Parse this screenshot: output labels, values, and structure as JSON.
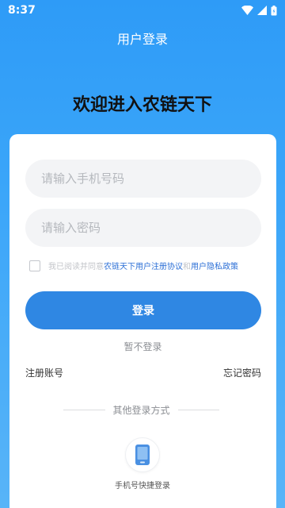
{
  "status_bar": {
    "time": "8:37"
  },
  "header": {
    "title": "用户登录"
  },
  "welcome": "欢迎进入农链天下",
  "form": {
    "phone_placeholder": "请输入手机号码",
    "phone_value": "",
    "password_placeholder": "请输入密码",
    "password_value": "",
    "agreement_checked": false,
    "agreement_prefix": "我已阅读并同意",
    "agreement_link1": "农链天下用户注册协议",
    "agreement_and": "和",
    "agreement_link2": "用户隐私政策",
    "login_label": "登录",
    "skip_label": "暂不登录",
    "register_label": "注册账号",
    "forgot_label": "忘记密码"
  },
  "other_login": {
    "title": "其他登录方式",
    "methods": [
      {
        "label": "手机号快捷登录",
        "icon": "phone-icon"
      }
    ]
  },
  "colors": {
    "primary": "#2f87e3",
    "background_top": "#2e9bf7",
    "link": "#2c6fd6"
  }
}
